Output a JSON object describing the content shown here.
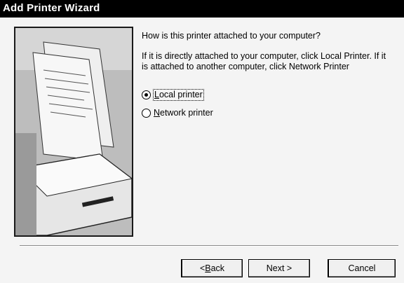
{
  "window": {
    "title": "Add Printer Wizard"
  },
  "illustration": {
    "icon": "printer-illustration-icon"
  },
  "content": {
    "question": "How is this printer attached to your computer?",
    "instruction": "If it is directly attached to your computer, click Local Printer. If it is attached to another computer, click Network Printer",
    "options": [
      {
        "label_underlined": "L",
        "label_rest": "ocal printer",
        "selected": true
      },
      {
        "label_underlined": "N",
        "label_rest": "etwork printer",
        "selected": false
      }
    ]
  },
  "buttons": {
    "back_prefix": "< ",
    "back_underlined": "B",
    "back_rest": "ack",
    "next_label": "Next >",
    "cancel_label": "Cancel"
  }
}
